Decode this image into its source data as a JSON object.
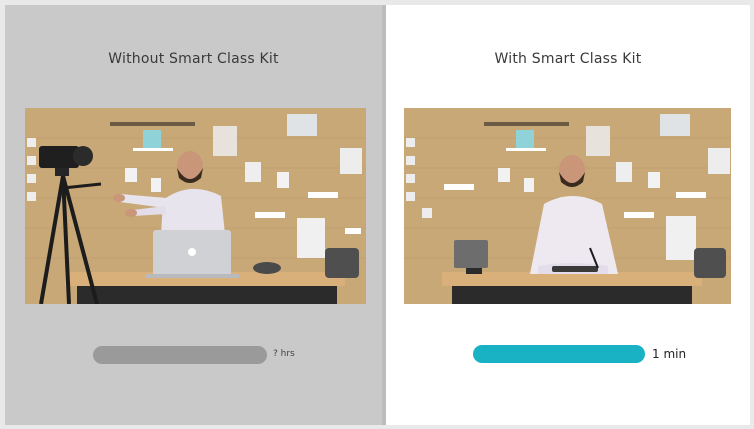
{
  "left_panel": {
    "title": "Without Smart Class Kit",
    "duration_label": "? hrs",
    "bar_color": "#9a9a9a",
    "background": "#c9c9c9"
  },
  "right_panel": {
    "title_highlight": "With",
    "title_rest": " Smart Class Kit",
    "duration_label": "1 min",
    "bar_color": "#18b2c4",
    "highlight_color": "#22b6c8",
    "background": "#ffffff"
  }
}
